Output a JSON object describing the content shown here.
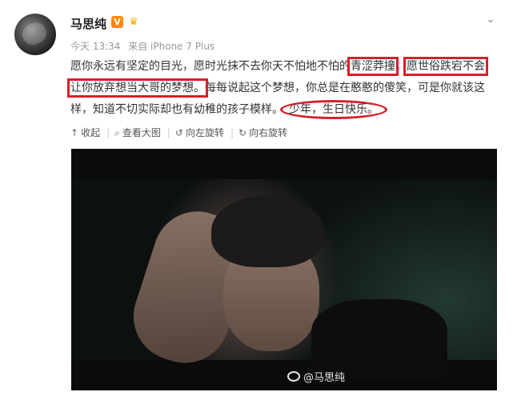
{
  "post": {
    "author": "马思纯",
    "verified_badge": "V",
    "vip_badge": "♛",
    "time": "今天 13:34",
    "source": "来自 iPhone 7 Plus",
    "text_parts": [
      {
        "text": "愿你永远有坚定的目光，愿时光抹不去你天不怕地不怕的",
        "highlight": "none"
      },
      {
        "text": "青涩莽撞",
        "highlight": "rect"
      },
      {
        "text": "，",
        "highlight": "none"
      },
      {
        "text": "愿世俗跌宕不会让你放弃想当大哥的梦想。",
        "highlight": "rect"
      },
      {
        "text": "每每说起这个梦想，你总是在憨憨的傻笑，可是你就该这样，知道不切实际却也有幼稚的孩子模样。",
        "highlight": "none"
      },
      {
        "text": "少年，生日快乐。",
        "highlight": "oval"
      }
    ]
  },
  "actions": [
    {
      "icon": "collapse-icon",
      "glyph": "↑",
      "label": "收起"
    },
    {
      "icon": "zoom-icon",
      "glyph": "⌕",
      "label": "查看大图"
    },
    {
      "icon": "rotate-left-icon",
      "glyph": "↺",
      "label": "向左旋转"
    },
    {
      "icon": "rotate-right-icon",
      "glyph": "↻",
      "label": "向右旋转"
    }
  ],
  "media": {
    "watermark": "@马思纯"
  },
  "colors": {
    "highlight": "#d4202a",
    "verified": "#ff8a00"
  }
}
